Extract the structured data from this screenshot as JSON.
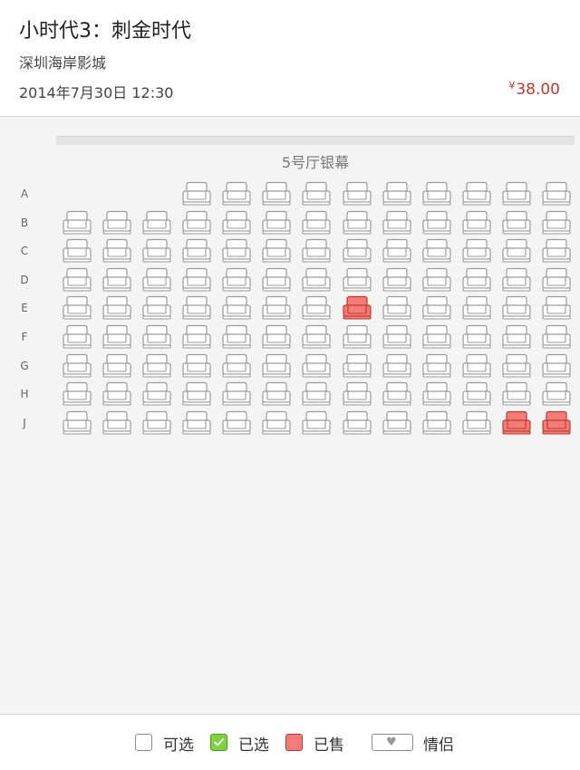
{
  "movie": {
    "title": "小时代3：刺金时代",
    "cinema": "深圳海岸影城",
    "showtime": "2014年7月30日 12:30",
    "price_symbol": "¥",
    "price": "38.00"
  },
  "screen": {
    "label": "5号厅银幕"
  },
  "colors": {
    "available_stroke": "#9a9a9a",
    "sold_fill": "#f17c78",
    "sold_stroke": "#c0392b",
    "selected_fill": "#7ed140",
    "price_color": "#c0392b"
  },
  "seat_map": {
    "columns": 13,
    "rows": [
      {
        "label": "A",
        "seats": [
          0,
          0,
          0,
          1,
          1,
          1,
          1,
          1,
          1,
          1,
          1,
          1,
          1
        ]
      },
      {
        "label": "B",
        "seats": [
          1,
          1,
          1,
          1,
          1,
          1,
          1,
          1,
          1,
          1,
          1,
          1,
          1
        ]
      },
      {
        "label": "C",
        "seats": [
          1,
          1,
          1,
          1,
          1,
          1,
          1,
          1,
          1,
          1,
          1,
          1,
          1
        ]
      },
      {
        "label": "D",
        "seats": [
          1,
          1,
          1,
          1,
          1,
          1,
          1,
          1,
          1,
          1,
          1,
          1,
          1
        ]
      },
      {
        "label": "E",
        "seats": [
          1,
          1,
          1,
          1,
          1,
          1,
          1,
          2,
          1,
          1,
          1,
          1,
          1
        ]
      },
      {
        "label": "F",
        "seats": [
          1,
          1,
          1,
          1,
          1,
          1,
          1,
          1,
          1,
          1,
          1,
          1,
          1
        ]
      },
      {
        "label": "G",
        "seats": [
          1,
          1,
          1,
          1,
          1,
          1,
          1,
          1,
          1,
          1,
          1,
          1,
          1
        ]
      },
      {
        "label": "H",
        "seats": [
          1,
          1,
          1,
          1,
          1,
          1,
          1,
          1,
          1,
          1,
          1,
          1,
          1
        ]
      },
      {
        "label": "J",
        "seats": [
          1,
          1,
          1,
          1,
          1,
          1,
          1,
          1,
          1,
          1,
          1,
          2,
          2
        ]
      }
    ],
    "status_legend": {
      "0": "none",
      "1": "available",
      "2": "sold"
    }
  },
  "legend": {
    "available": "可选",
    "selected": "已选",
    "sold": "已售",
    "couple": "情侣",
    "couple_icon": "heart-icon",
    "selected_icon": "check-icon"
  }
}
